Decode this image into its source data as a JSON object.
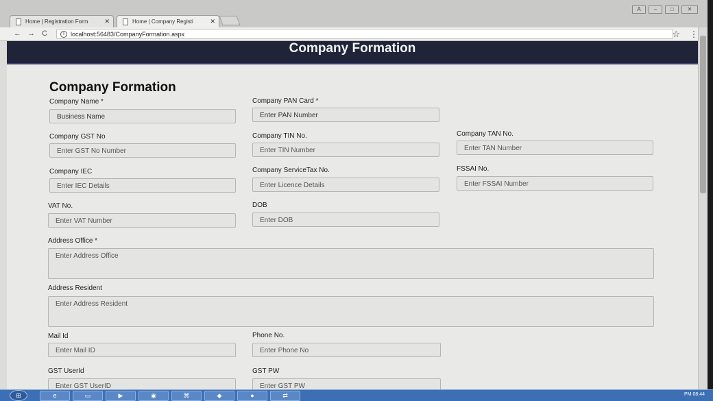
{
  "browser": {
    "tabs": [
      {
        "title": "Home | Registration Form"
      },
      {
        "title": "Home | Company Registi"
      }
    ],
    "url": "localhost:56483/CompanyFormation.aspx"
  },
  "header": {
    "title": "Company Formation"
  },
  "form": {
    "title": "Company Formation",
    "fields": {
      "company_name": {
        "label": "Company Name *",
        "value": "Business Name"
      },
      "company_pan": {
        "label": "Company PAN Card *",
        "value": "Enter PAN Number"
      },
      "company_gst": {
        "label": "Company GST No",
        "placeholder": "Enter GST No Number"
      },
      "company_tin": {
        "label": "Company TIN No.",
        "placeholder": "Enter TIN Number"
      },
      "company_tan": {
        "label": "Company TAN No.",
        "placeholder": "Enter TAN Number"
      },
      "company_iec": {
        "label": "Company IEC",
        "placeholder": "Enter IEC Details"
      },
      "company_servicetax": {
        "label": "Company ServiceTax No.",
        "placeholder": "Enter Licence Details"
      },
      "fssai": {
        "label": "FSSAI No.",
        "placeholder": "Enter FSSAI Number"
      },
      "vat": {
        "label": "VAT No.",
        "placeholder": "Enter VAT Number"
      },
      "dob": {
        "label": "DOB",
        "placeholder": "Enter DOB"
      },
      "address_office": {
        "label": "Address Office *",
        "placeholder": "Enter Address Office"
      },
      "address_resident": {
        "label": "Address Resident",
        "placeholder": "Enter  Address Resident"
      },
      "mail_id": {
        "label": "Mail Id",
        "placeholder": "Enter Mail ID"
      },
      "phone_no": {
        "label": "Phone No.",
        "placeholder": "Enter Phone No"
      },
      "gst_userid": {
        "label": "GST UserId",
        "placeholder": "Enter GST UserID"
      },
      "gst_pw": {
        "label": "GST PW",
        "placeholder": "Enter GST PW"
      }
    }
  },
  "taskbar": {
    "clock": "PM 08:44"
  }
}
